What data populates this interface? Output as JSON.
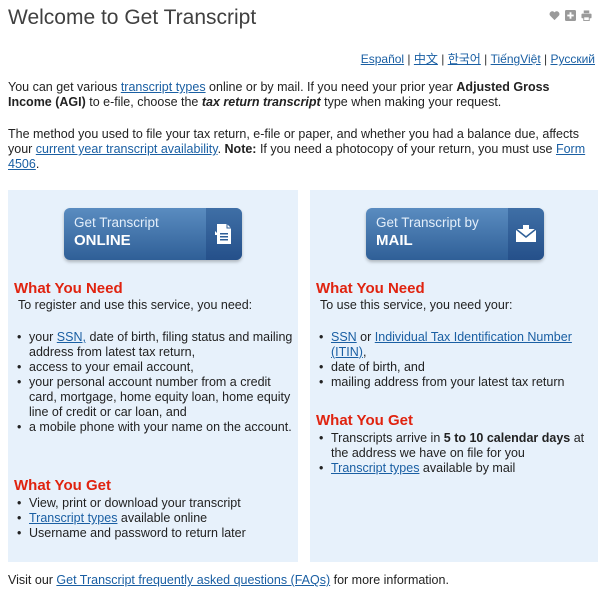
{
  "page": {
    "title": "Welcome to Get Transcript"
  },
  "toolbar_icons": [
    "heart-icon",
    "plus-icon",
    "print-icon"
  ],
  "languages": {
    "items": [
      "Español",
      "中文",
      "한국어",
      "TiếngViệt",
      "Русский"
    ],
    "separator": " | "
  },
  "intro": {
    "p1_a": "You can get various ",
    "p1_link": "transcript types",
    "p1_b": " online or by mail. If you need your prior year ",
    "p1_bold": "Adjusted Gross Income (AGI)",
    "p1_c": " to e-file, choose the ",
    "p1_em": "tax return transcript",
    "p1_d": " type when making your request.",
    "p2_a": "The method you used to file your tax return, e-file or paper, and whether you had a balance due, affects your ",
    "p2_link": "current year transcript availability",
    "p2_b": ". ",
    "p2_bold": "Note:",
    "p2_c": " If you need a photocopy of your return, you must use ",
    "p2_link2": "Form 4506",
    "p2_d": "."
  },
  "online": {
    "button_line1": "Get Transcript",
    "button_line2": "ONLINE",
    "need_heading": "What You Need",
    "need_sub": "To register and use this service, you need:",
    "need_item1_a": "your ",
    "need_item1_link": "SSN,",
    "need_item1_b": " date of birth, filing status and mailing address from latest tax return,",
    "need_item2": "access to your email account,",
    "need_item3": "your personal account number from a credit card, mortgage, home equity loan, home equity line of credit or car loan, and",
    "need_item4": "a mobile phone with your name on the account.",
    "get_heading": "What You Get",
    "get_item1": "View, print or download your transcript",
    "get_item2_link": "Transcript types",
    "get_item2_b": " available online",
    "get_item3": "Username and password to return later"
  },
  "mail": {
    "button_line1": "Get Transcript by",
    "button_line2": "MAIL",
    "need_heading": "What You Need",
    "need_sub": "To use this service, you need your:",
    "need_item1_link1": "SSN",
    "need_item1_mid": " or ",
    "need_item1_link2": "Individual Tax Identification Number (ITIN)",
    "need_item1_end": ",",
    "need_item2": "date of birth, and",
    "need_item3": "mailing address from your latest tax return",
    "get_heading": "What You Get",
    "get_item1_a": "Transcripts arrive in ",
    "get_item1_bold": "5 to 10 calendar days",
    "get_item1_b": " at the address we have on file for you",
    "get_item2_link": "Transcript types",
    "get_item2_b": " available by mail"
  },
  "footer": {
    "a": "Visit our ",
    "link": "Get Transcript frequently asked questions (FAQs)",
    "b": " for more information."
  }
}
